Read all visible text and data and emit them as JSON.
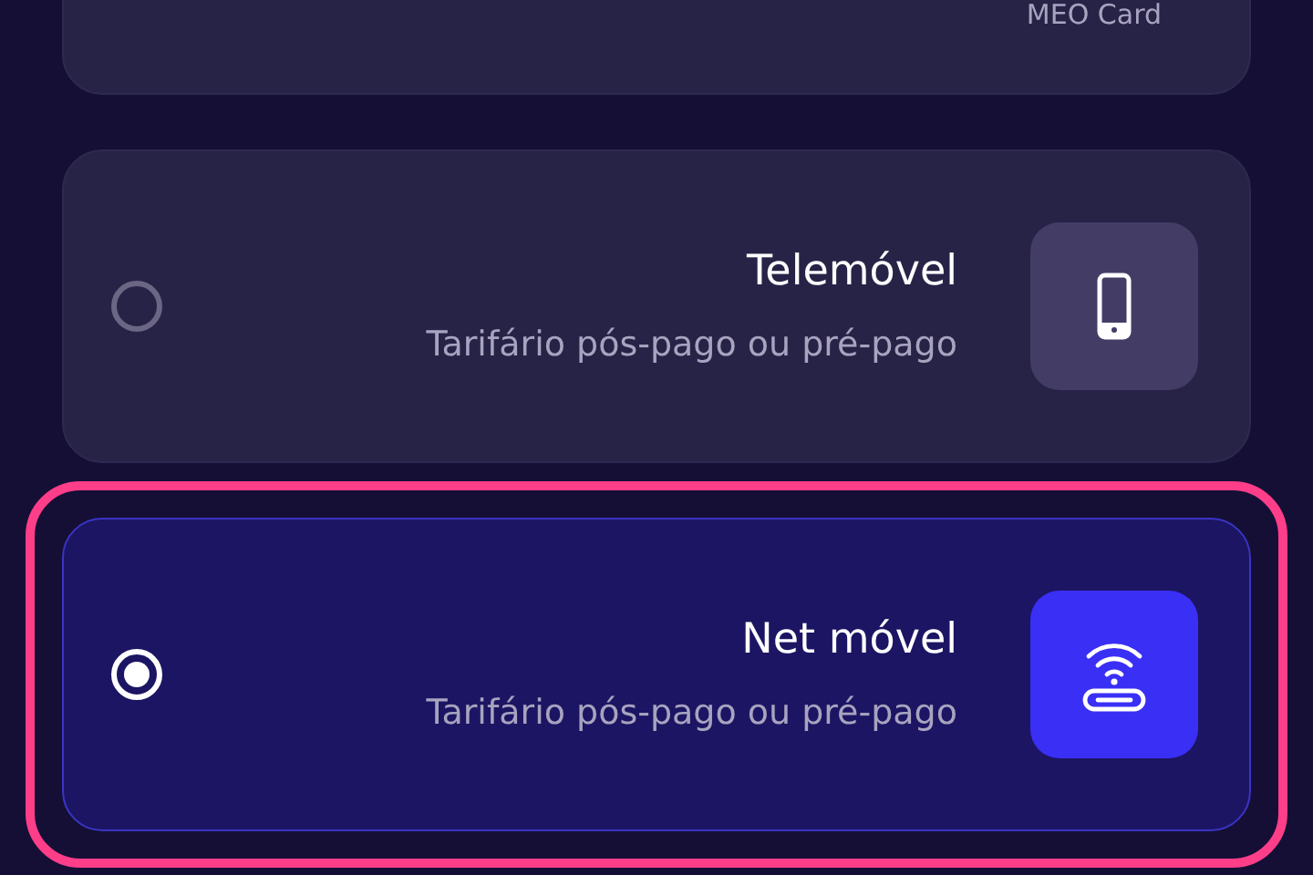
{
  "options": [
    {
      "kind": "partial",
      "subtitle": "MEO Card"
    },
    {
      "kind": "phone",
      "title": "Telemóvel",
      "subtitle": "Tarifário pós-pago ou pré-pago",
      "selected": false
    },
    {
      "kind": "router",
      "title": "Net móvel",
      "subtitle": "Tarifário pós-pago ou pré-pago",
      "selected": true
    }
  ]
}
